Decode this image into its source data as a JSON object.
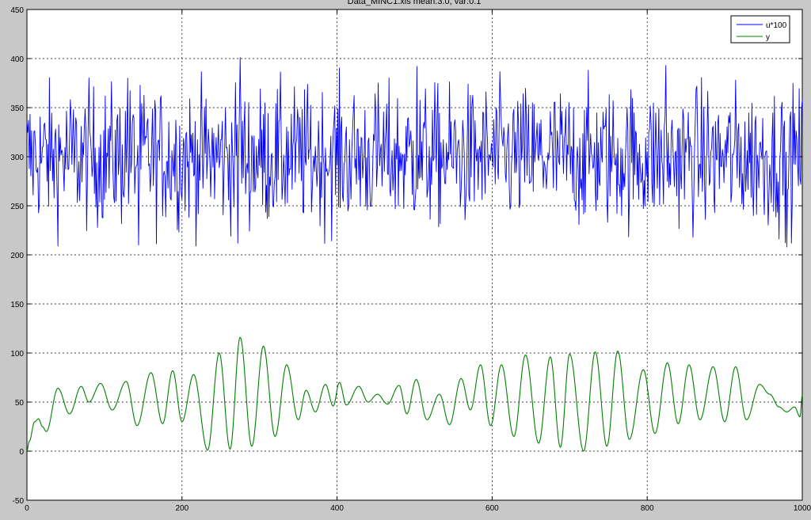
{
  "figure": {
    "background": "#c8c8c8"
  },
  "chart_data": {
    "type": "line",
    "title": "Data_MINC1.xls mean:3.0, var:0.1",
    "xlabel": "",
    "ylabel": "",
    "xlim": [
      0,
      1000
    ],
    "ylim": [
      -50,
      450
    ],
    "xticks": [
      0,
      200,
      400,
      600,
      800,
      1000
    ],
    "yticks": [
      -50,
      0,
      50,
      100,
      150,
      200,
      250,
      300,
      350,
      400,
      450
    ],
    "grid": true,
    "legend_position": "top-right",
    "series": [
      {
        "name": "u*100",
        "color": "#0000ff",
        "generator": "noise",
        "mean": 300,
        "spread": 35,
        "range": [
          209,
          401
        ],
        "samples": 1000,
        "peaks": [
          [
            130,
            380
          ],
          [
            275,
            401
          ],
          [
            503,
            392
          ],
          [
            824,
            393
          ],
          [
            980,
            208
          ],
          [
            272,
            212
          ],
          [
            144,
            210
          ]
        ]
      },
      {
        "name": "y",
        "color": "#008000",
        "generator": "anchors",
        "anchors": [
          [
            0,
            0
          ],
          [
            3,
            10
          ],
          [
            10,
            30
          ],
          [
            15,
            33
          ],
          [
            20,
            25
          ],
          [
            25,
            20
          ],
          [
            40,
            64
          ],
          [
            55,
            38
          ],
          [
            70,
            66
          ],
          [
            80,
            50
          ],
          [
            95,
            69
          ],
          [
            110,
            42
          ],
          [
            128,
            71
          ],
          [
            142,
            26
          ],
          [
            160,
            80
          ],
          [
            175,
            28
          ],
          [
            188,
            82
          ],
          [
            200,
            30
          ],
          [
            215,
            78
          ],
          [
            233,
            1
          ],
          [
            248,
            100
          ],
          [
            262,
            2
          ],
          [
            275,
            116
          ],
          [
            290,
            5
          ],
          [
            305,
            107
          ],
          [
            320,
            15
          ],
          [
            335,
            88
          ],
          [
            350,
            32
          ],
          [
            360,
            62
          ],
          [
            372,
            40
          ],
          [
            385,
            68
          ],
          [
            395,
            46
          ],
          [
            403,
            70
          ],
          [
            412,
            47
          ],
          [
            428,
            66
          ],
          [
            440,
            50
          ],
          [
            452,
            58
          ],
          [
            465,
            48
          ],
          [
            480,
            67
          ],
          [
            490,
            38
          ],
          [
            502,
            73
          ],
          [
            516,
            32
          ],
          [
            532,
            58
          ],
          [
            545,
            27
          ],
          [
            560,
            74
          ],
          [
            572,
            42
          ],
          [
            585,
            88
          ],
          [
            598,
            26
          ],
          [
            612,
            88
          ],
          [
            628,
            15
          ],
          [
            643,
            98
          ],
          [
            660,
            8
          ],
          [
            675,
            96
          ],
          [
            688,
            4
          ],
          [
            700,
            99
          ],
          [
            718,
            0
          ],
          [
            733,
            101
          ],
          [
            748,
            5
          ],
          [
            762,
            102
          ],
          [
            777,
            12
          ],
          [
            795,
            83
          ],
          [
            810,
            18
          ],
          [
            826,
            90
          ],
          [
            840,
            28
          ],
          [
            854,
            88
          ],
          [
            868,
            32
          ],
          [
            885,
            86
          ],
          [
            900,
            30
          ],
          [
            914,
            86
          ],
          [
            928,
            32
          ],
          [
            945,
            68
          ],
          [
            958,
            58
          ],
          [
            970,
            45
          ],
          [
            980,
            40
          ],
          [
            990,
            45
          ],
          [
            997,
            35
          ],
          [
            1000,
            57
          ]
        ]
      }
    ]
  }
}
